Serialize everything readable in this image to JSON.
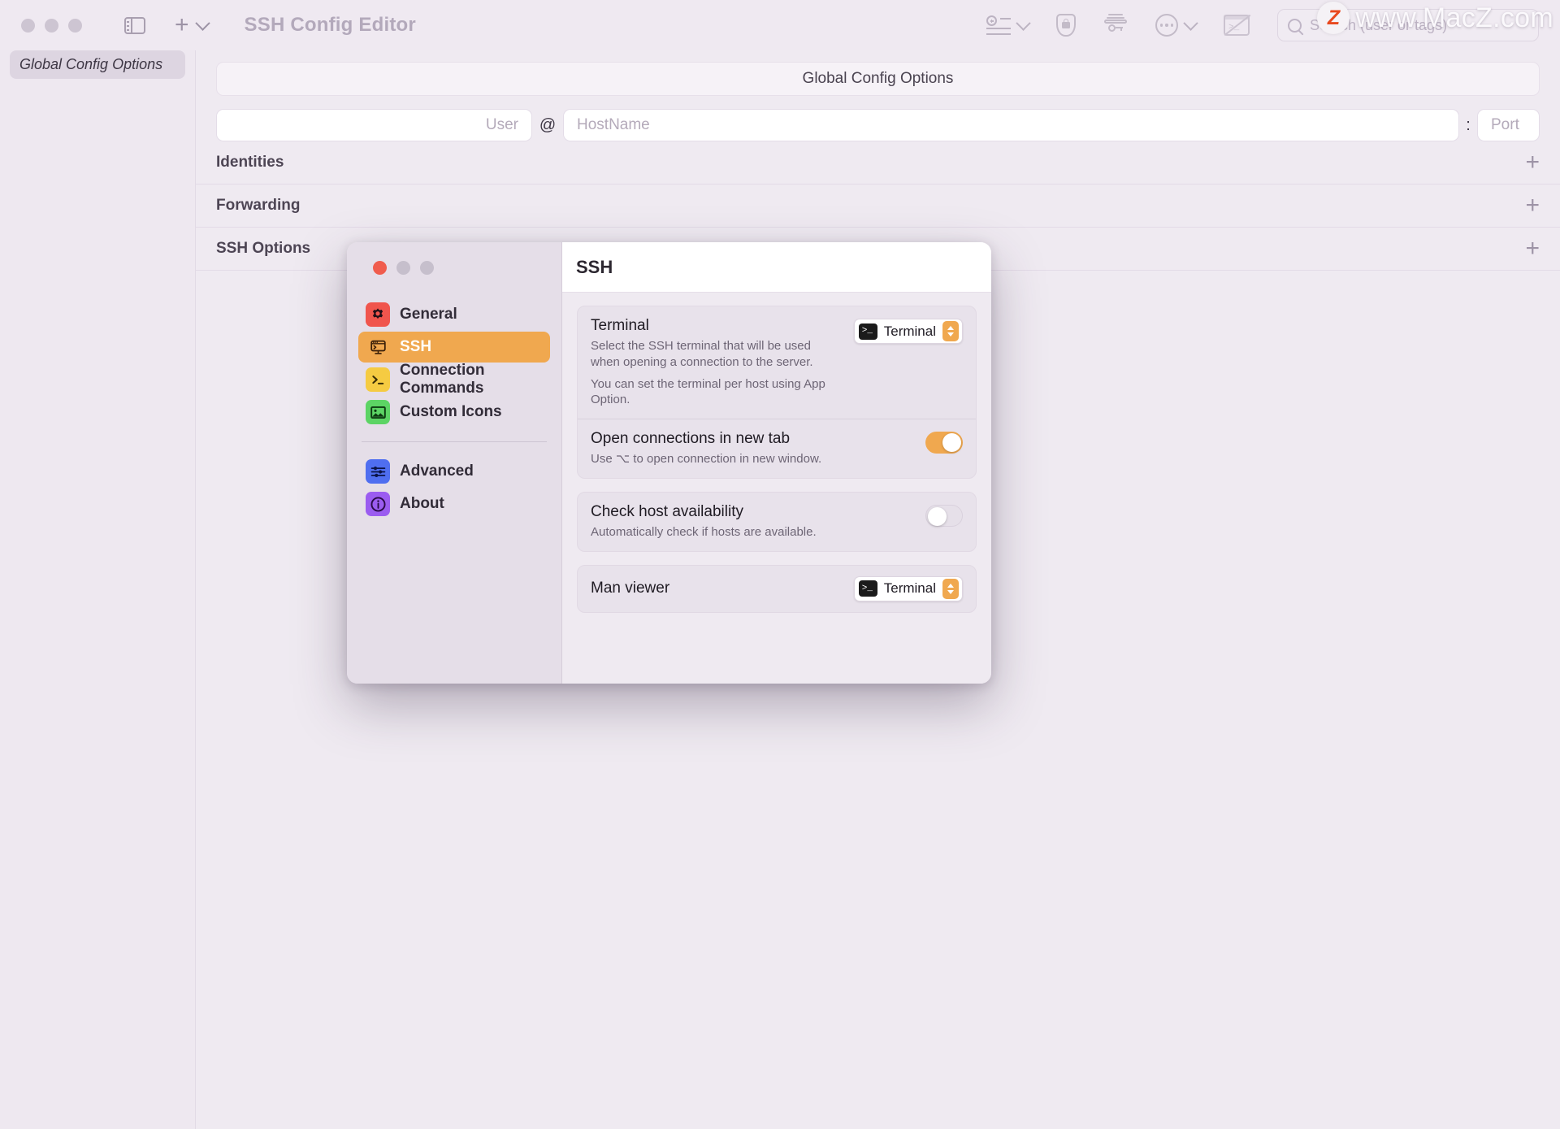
{
  "window": {
    "title": "SSH Config Editor",
    "traffic_lights": [
      "close",
      "minimize",
      "zoom"
    ]
  },
  "toolbar": {
    "sidebar_toggle_icon": "sidebar-toggle-icon",
    "add_label": "+",
    "icons": [
      {
        "name": "list-add-icon",
        "label": "Add entry"
      },
      {
        "name": "shield-lock-icon",
        "label": "Security"
      },
      {
        "name": "key-card-icon",
        "label": "Keys"
      },
      {
        "name": "ellipsis-circle-icon",
        "label": "More"
      },
      {
        "name": "terminal-off-icon",
        "label": "Terminal disabled"
      }
    ],
    "search": {
      "placeholder": "Search (user or tags)",
      "value": ""
    }
  },
  "watermark": {
    "logo": "Z",
    "text": "www.MacZ.com"
  },
  "sidebar": {
    "items": [
      {
        "label": "Global Config Options",
        "selected": true
      }
    ]
  },
  "main": {
    "global_bar": "Global Config Options",
    "host": {
      "user_placeholder": "User",
      "at": "@",
      "hostname_placeholder": "HostName",
      "colon": ":",
      "port_placeholder": "Port"
    },
    "sections": [
      {
        "title": "Identities",
        "add": "+"
      },
      {
        "title": "Forwarding",
        "add": "+"
      },
      {
        "title": "SSH Options",
        "add": "+"
      }
    ]
  },
  "settings_dialog": {
    "header_title": "SSH",
    "sidebar_items": [
      {
        "label": "General",
        "icon": "gear-icon",
        "color": "red",
        "selected": false
      },
      {
        "label": "SSH",
        "icon": "terminal-window-icon",
        "color": "orange",
        "selected": true
      },
      {
        "label": "Connection Commands",
        "icon": "command-prompt-icon",
        "color": "yellow",
        "selected": false
      },
      {
        "label": "Custom Icons",
        "icon": "image-icon",
        "color": "green",
        "selected": false
      }
    ],
    "sidebar_items_secondary": [
      {
        "label": "Advanced",
        "icon": "sliders-icon",
        "color": "blue",
        "selected": false
      },
      {
        "label": "About",
        "icon": "info-circle-icon",
        "color": "purple",
        "selected": false
      }
    ],
    "rows": [
      {
        "title": "Terminal",
        "desc1": "Select the SSH terminal that will be used when opening a connection to the server.",
        "desc2": "You can set the terminal per host using App Option.",
        "control": "popup",
        "value": "Terminal"
      },
      {
        "title": "Open connections in new tab",
        "desc1": "Use ⌥ to open connection in new window.",
        "control": "toggle",
        "value": "on"
      },
      {
        "title": "Check host availability",
        "desc1": "Automatically check if hosts are available.",
        "control": "toggle",
        "value": "off"
      },
      {
        "title": "Man viewer",
        "control": "popup",
        "value": "Terminal"
      }
    ]
  },
  "colors": {
    "accent": "#f0a84f",
    "close_red": "#f05c4d",
    "bg": "#efeaf1"
  }
}
